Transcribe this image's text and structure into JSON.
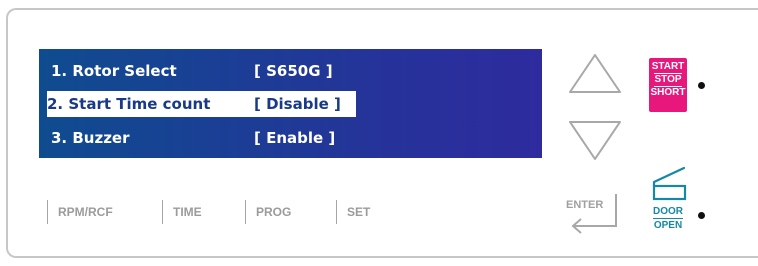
{
  "display": {
    "rows": [
      {
        "label": "1. Rotor Select",
        "value": "[ S650G ]",
        "selected": false
      },
      {
        "label": "2. Start Time count",
        "value": "[ Disable ]",
        "selected": true
      },
      {
        "label": "3. Buzzer",
        "value": "[ Enable ]",
        "selected": false
      }
    ]
  },
  "softkeys": [
    "RPM/RCF",
    "TIME",
    "PROG",
    "SET"
  ],
  "keys": {
    "up_icon": "triangle-up-icon",
    "down_icon": "triangle-down-icon",
    "enter_label": "ENTER",
    "enter_icon": "enter-arrow-icon"
  },
  "start_stop": {
    "line1": "START",
    "line2": "STOP",
    "line3": "SHORT",
    "color": "#e8177c"
  },
  "door": {
    "line1": "DOOR",
    "line2": "OPEN",
    "color": "#1688a7",
    "icon": "lid-open-icon"
  }
}
